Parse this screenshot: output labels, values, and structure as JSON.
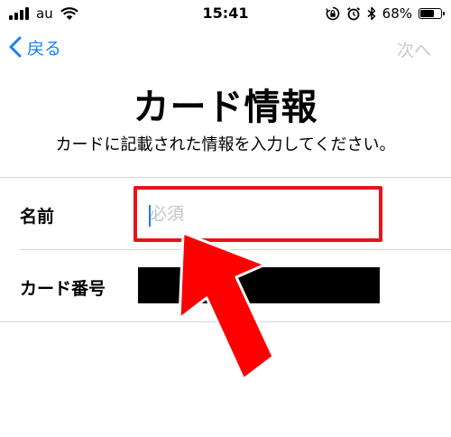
{
  "status_bar": {
    "carrier": "au",
    "time": "15:41",
    "battery_percent": "68%",
    "battery_level": 0.68,
    "icons": [
      "signal-icon",
      "wifi-icon",
      "rotation-lock-icon",
      "alarm-icon",
      "bluetooth-icon",
      "battery-icon"
    ]
  },
  "nav": {
    "back_label": "戻る",
    "next_label": "次へ"
  },
  "header": {
    "title": "カード情報",
    "subtitle": "カードに記載された情報を入力してください。"
  },
  "form": {
    "name_label": "名前",
    "name_placeholder": "必須",
    "name_value": "",
    "card_number_label": "カード番号"
  },
  "colors": {
    "accent": "#1a7ef5",
    "disabled": "#c9c9cd",
    "highlight": "#e8141b",
    "arrow": "#ff0000"
  }
}
